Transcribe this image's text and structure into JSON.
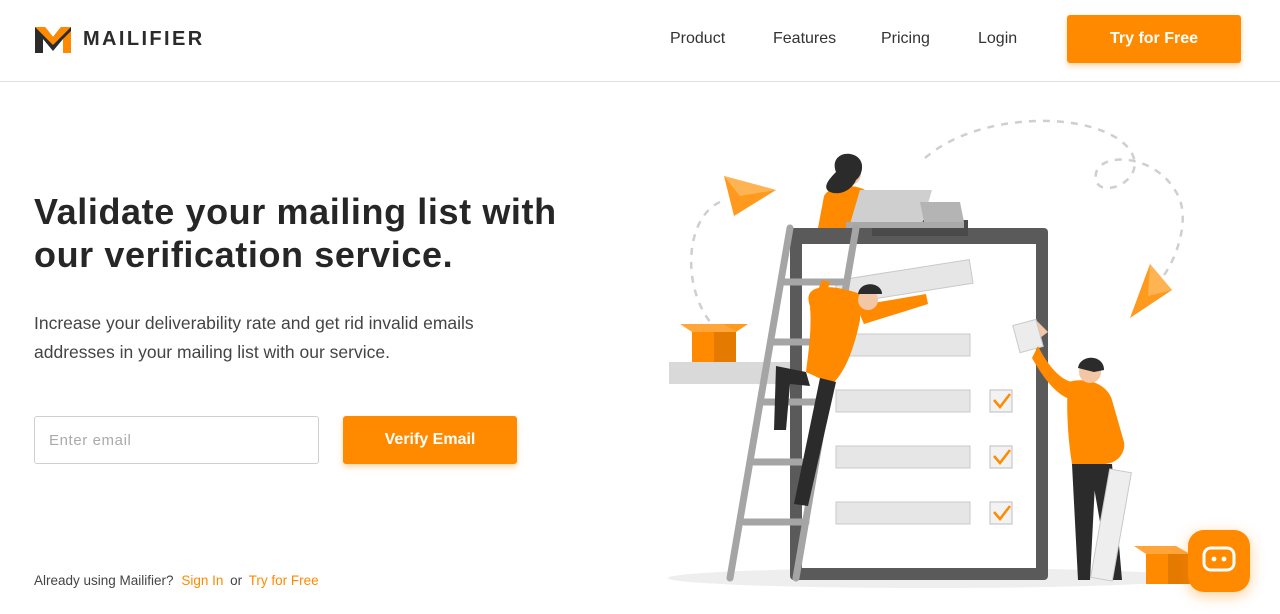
{
  "brand": {
    "name": "MAILIFIER",
    "icon": "mailifier-m-logo-icon"
  },
  "nav": {
    "items": [
      {
        "label": "Product"
      },
      {
        "label": "Features"
      },
      {
        "label": "Pricing"
      },
      {
        "label": "Login"
      }
    ],
    "cta_label": "Try for Free"
  },
  "hero": {
    "title_line1": "Validate your mailing list with",
    "title_line2": "our verification service.",
    "subtitle_line1": "Increase your deliverability rate and get rid invalid emails",
    "subtitle_line2": "addresses in your mailing list with our service.",
    "email_placeholder": "Enter email",
    "verify_label": "Verify Email"
  },
  "footer_prompt": {
    "text": "Already using Mailifier?",
    "sign_in": "Sign In",
    "or": "or",
    "try_free": "Try for Free"
  },
  "chat": {
    "icon": "chat-bubble-icon"
  },
  "colors": {
    "accent": "#ff8a00",
    "dark": "#2b2b2b",
    "gray": "#d9d9d9"
  }
}
